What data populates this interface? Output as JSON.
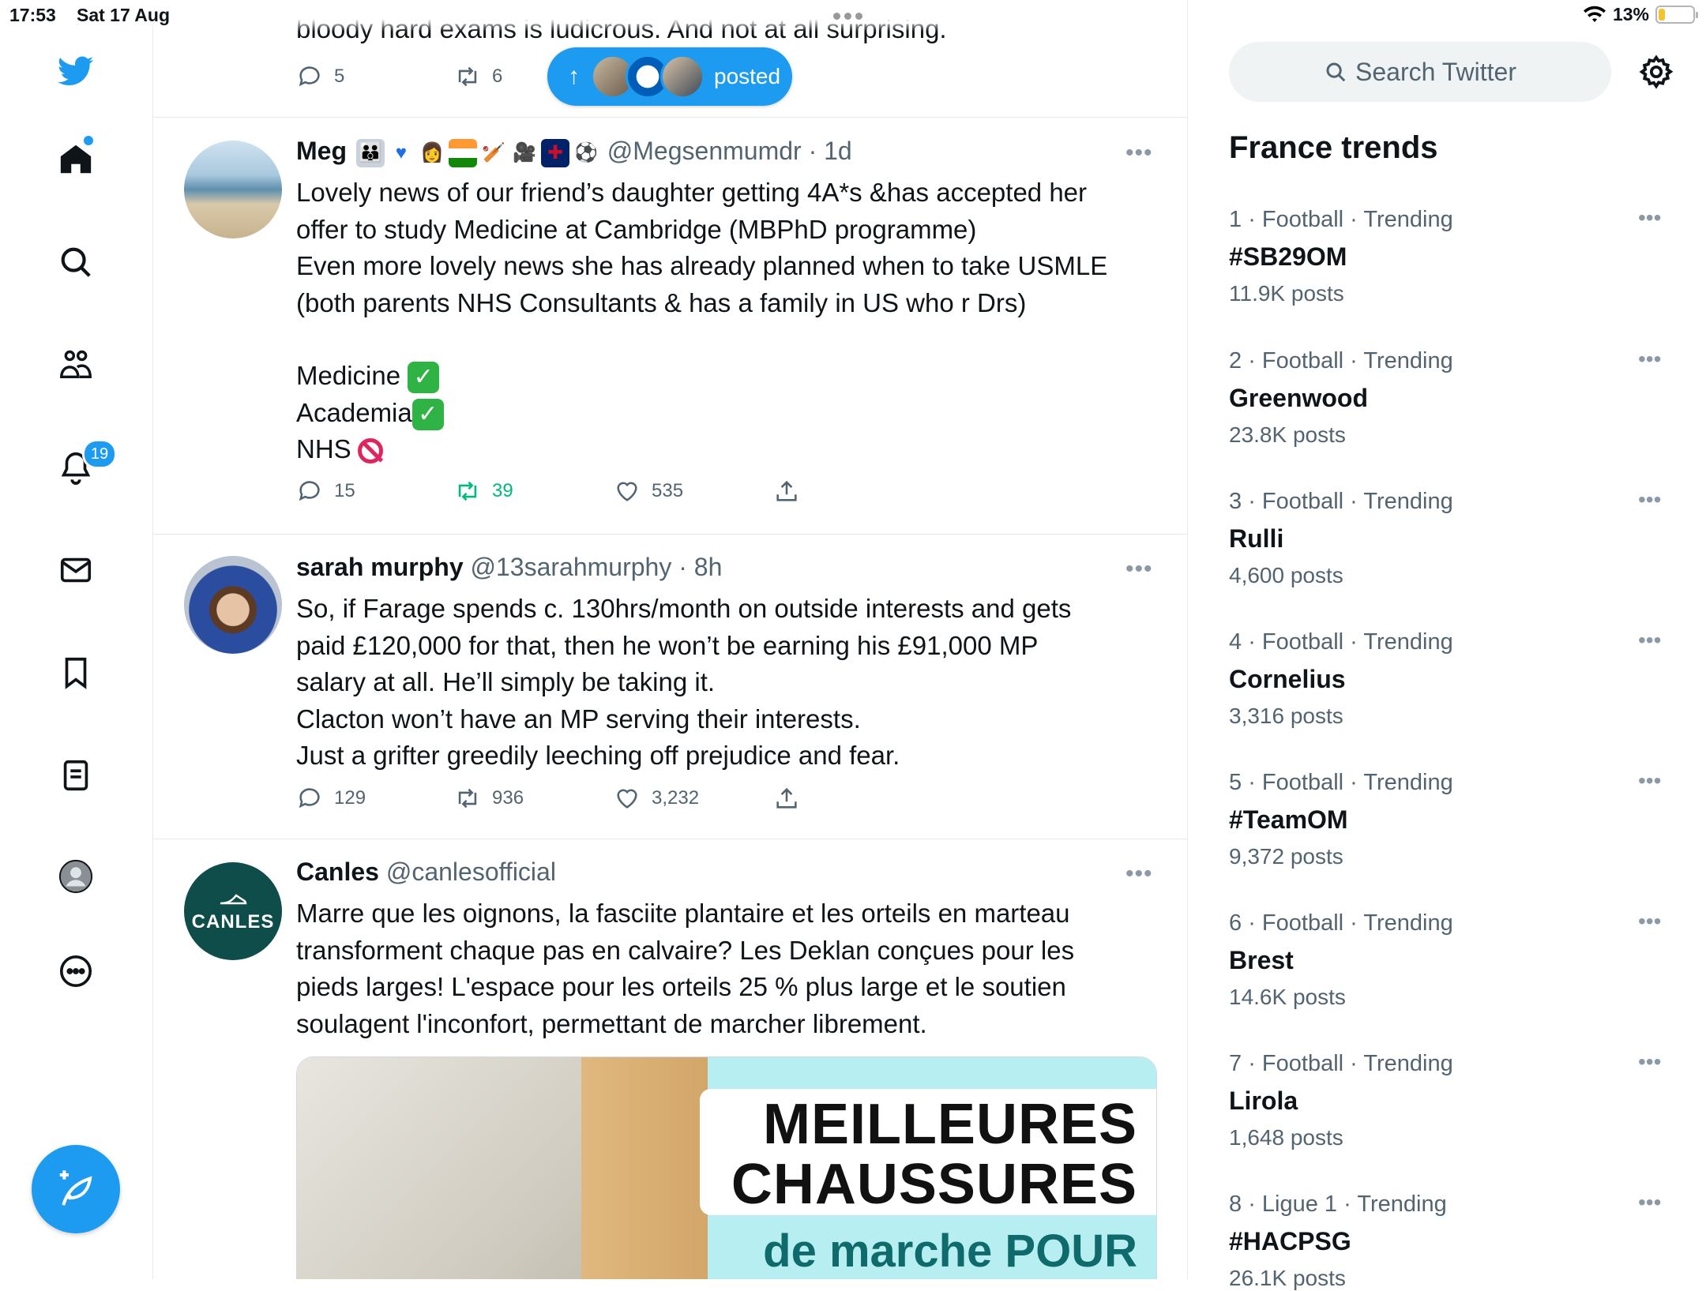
{
  "status_bar": {
    "time": "17:53",
    "date": "Sat 17 Aug",
    "battery": "13%",
    "battery_level": 0.13
  },
  "nav": {
    "notifications_count": "19",
    "items": [
      "home-icon",
      "search-icon",
      "communities-icon",
      "notifications-icon",
      "messages-icon",
      "bookmarks-icon",
      "lists-icon",
      "profile-icon",
      "more-icon"
    ]
  },
  "feed": {
    "prev_tweet_text": "bloody hard exams is ludicrous. And not at all surprising.",
    "prev_tweet_replies": "5",
    "prev_tweet_retweets": "6",
    "posted_pill_label": "posted",
    "tweets": [
      {
        "name": "Meg",
        "handle": "@Megsenmumdr",
        "time": "1d",
        "lines": [
          "Lovely news of our friend’s daughter getting 4A*s &has accepted her",
          "offer to study Medicine at Cambridge (MBPhD programme)",
          "Even more lovely news she has already planned when to take USMLE",
          "(both parents NHS Consultants & has a family in US who r Drs)"
        ],
        "list": [
          "Medicine",
          "Academia",
          "NHS"
        ],
        "replies": "15",
        "retweets": "39",
        "likes": "535"
      },
      {
        "name": "sarah murphy",
        "handle": "@13sarahmurphy",
        "time": "8h",
        "lines": [
          "So, if Farage spends c. 130hrs/month on outside interests and gets",
          "paid £120,000 for that, then he won’t be earning his £91,000 MP",
          "salary at all. He’ll simply be taking it.",
          "Clacton won’t have an MP serving their interests.",
          "Just a grifter greedily leeching off prejudice and fear."
        ],
        "replies": "129",
        "retweets": "936",
        "likes": "3,232"
      },
      {
        "name": "Canles",
        "handle": "@canlesofficial",
        "avatar_text": "CANLES",
        "lines": [
          "Marre que les oignons, la fasciite plantaire et les orteils en marteau",
          "transforment chaque pas en calvaire? Les Deklan conçues pour les",
          "pieds larges! L'espace pour les orteils 25 % plus large et le soutien",
          "soulagent l'inconfort, permettant de marcher librement."
        ],
        "ad_line1": "MEILLEURES",
        "ad_line2": "CHAUSSURES",
        "ad_line3": "de marche POUR"
      }
    ]
  },
  "sidebar": {
    "search_placeholder": "Search Twitter",
    "trends_title": "France trends",
    "trends": [
      {
        "rank": "1",
        "category": "Football",
        "label": "Trending",
        "name": "#SB29OM",
        "count": "11.9K posts"
      },
      {
        "rank": "2",
        "category": "Football",
        "label": "Trending",
        "name": "Greenwood",
        "count": "23.8K posts"
      },
      {
        "rank": "3",
        "category": "Football",
        "label": "Trending",
        "name": "Rulli",
        "count": "4,600 posts"
      },
      {
        "rank": "4",
        "category": "Football",
        "label": "Trending",
        "name": "Cornelius",
        "count": "3,316 posts"
      },
      {
        "rank": "5",
        "category": "Football",
        "label": "Trending",
        "name": "#TeamOM",
        "count": "9,372 posts"
      },
      {
        "rank": "6",
        "category": "Football",
        "label": "Trending",
        "name": "Brest",
        "count": "14.6K posts"
      },
      {
        "rank": "7",
        "category": "Football",
        "label": "Trending",
        "name": "Lirola",
        "count": "1,648 posts"
      },
      {
        "rank": "8",
        "category": "Ligue 1",
        "label": "Trending",
        "name": "#HACPSG",
        "count": "26.1K posts"
      }
    ]
  },
  "colors": {
    "accent": "#1d9bf0",
    "retweet_active": "#00ba7c",
    "muted": "#536471"
  }
}
